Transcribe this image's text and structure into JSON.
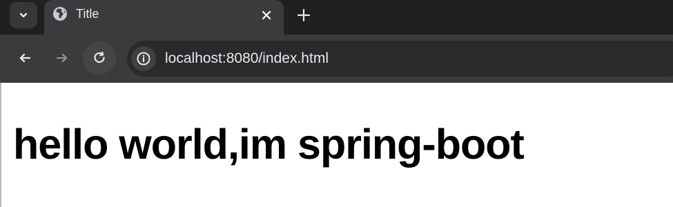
{
  "browser": {
    "tab": {
      "title": "Title"
    },
    "address_bar": {
      "url": "localhost:8080/index.html"
    },
    "icons": {
      "tab_search": "chevron-down-icon",
      "favicon": "globe-icon",
      "close_tab": "close-icon",
      "new_tab": "plus-icon",
      "back": "back-arrow-icon",
      "forward": "forward-arrow-icon",
      "reload": "reload-icon",
      "site_info": "info-icon"
    },
    "colors": {
      "tabstrip": "#1f2021",
      "active_tab": "#3a3b3d",
      "toolbar": "#3a3b3d",
      "omnibox": "#292a2c",
      "content_background": "#ffffff",
      "heading_text": "#000000"
    }
  },
  "page": {
    "heading": "hello world,im spring-boot"
  }
}
